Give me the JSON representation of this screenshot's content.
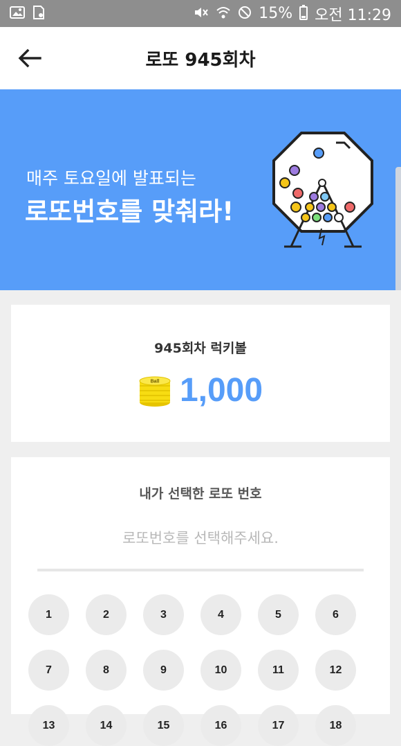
{
  "status_bar": {
    "battery": "15%",
    "time": "오전 11:29",
    "icons": [
      "image-icon",
      "sd-card-icon",
      "mute-icon",
      "wifi-icon",
      "no-disturb-icon",
      "battery-icon"
    ]
  },
  "app_bar": {
    "title": "로또 945회차",
    "back_icon": "arrow-left-icon"
  },
  "banner": {
    "subtitle": "매주 토요일에 발표되는",
    "title": "로또번호를 맞춰라!",
    "colors": {
      "background": "#579df9"
    }
  },
  "lucky_ball": {
    "title": "945회차 럭키볼",
    "amount": "1,000",
    "coin_icon": "coin-stack-icon",
    "coin_label": "Ball"
  },
  "picker": {
    "title": "내가 선택한 로또 번호",
    "placeholder": "로또번호를 선택해주세요.",
    "numbers": [
      "1",
      "2",
      "3",
      "4",
      "5",
      "6",
      "7",
      "8",
      "9",
      "10",
      "11",
      "12",
      "13",
      "14",
      "15",
      "16",
      "17",
      "18"
    ]
  }
}
